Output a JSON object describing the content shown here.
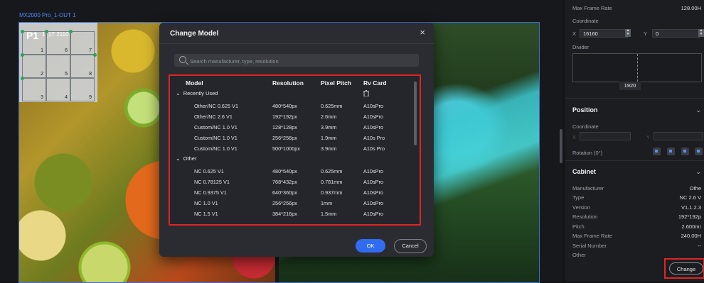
{
  "canvas": {
    "output_label": "MX2000 Pro_1-OUT 1",
    "mapping_title": "P1",
    "mapping_subtitle": "1_1T 2110",
    "cells": [
      "1",
      "2",
      "3",
      "4",
      "5",
      "6",
      "7",
      "8",
      "9"
    ]
  },
  "modal": {
    "title": "Change Model",
    "close_icon": "×",
    "search_placeholder": "Search manufacturer, type, resolution",
    "columns": {
      "model": "Model",
      "resolution": "Resolution",
      "pixel_pitch": "Pixel Pitch",
      "rv_card": "Rv Card"
    },
    "groups": [
      {
        "name": "Recently Used",
        "rows": [
          {
            "model": "Other/NC 0.625 V1",
            "resolution": "480*540px",
            "pitch": "0.625mm",
            "card": "A10sPro"
          },
          {
            "model": "Other/NC 2.6 V1",
            "resolution": "192*192px",
            "pitch": "2.6mm",
            "card": "A10sPro"
          },
          {
            "model": "Custom/NC 1.0 V1",
            "resolution": "128*128px",
            "pitch": "3.9mm",
            "card": "A10sPro"
          },
          {
            "model": "Custom/NC 1.0 V1",
            "resolution": "256*256px",
            "pitch": "1.9mm",
            "card": "A10s Pro"
          },
          {
            "model": "Custom/NC 1.0 V1",
            "resolution": "500*1000px",
            "pitch": "3.9mm",
            "card": "A10s Pro"
          }
        ]
      },
      {
        "name": "Other",
        "rows": [
          {
            "model": "NC 0.625 V1",
            "resolution": "480*540px",
            "pitch": "0.625mm",
            "card": "A10sPro"
          },
          {
            "model": "NC 0.78125 V1",
            "resolution": "768*432px",
            "pitch": "0.781mm",
            "card": "A10sPro"
          },
          {
            "model": "NC 0.9375 V1",
            "resolution": "640*360px",
            "pitch": "0.937mm",
            "card": "A10sPro"
          },
          {
            "model": "NC 1.0 V1",
            "resolution": "256*256px",
            "pitch": "1mm",
            "card": "A10sPro"
          },
          {
            "model": "NC 1.5 V1",
            "resolution": "384*216px",
            "pitch": "1.5mm",
            "card": "A10sPro"
          }
        ]
      }
    ],
    "ok_label": "OK",
    "cancel_label": "Cancel"
  },
  "right_panel": {
    "max_frame_rate_label": "Max Frame Rate",
    "max_frame_rate_value": "128.00H",
    "coordinate_label": "Coordinate",
    "x_label": "X",
    "x_value": "16160",
    "y_label": "Y",
    "y_value": "0",
    "divider_label": "Divider",
    "divider_value": "1920",
    "position": {
      "title": "Position",
      "coordinate_label": "Coordinate",
      "x_label": "X",
      "y_label": "Y",
      "rotation_label": "Rotation (0°)"
    },
    "cabinet": {
      "title": "Cabinet",
      "fields": [
        {
          "label": "Manufacturer",
          "value": "Othe"
        },
        {
          "label": "Type",
          "value": "NC 2.6 V"
        },
        {
          "label": "Version",
          "value": "V1.1.2.3"
        },
        {
          "label": "Resolution",
          "value": "192*192p"
        },
        {
          "label": "Pitch",
          "value": "2.600mr"
        },
        {
          "label": "Max Frame Rate",
          "value": "240.00H"
        },
        {
          "label": "Serial Number",
          "value": "--"
        },
        {
          "label": "Other",
          "value": ""
        }
      ],
      "change_label": "Change"
    }
  }
}
